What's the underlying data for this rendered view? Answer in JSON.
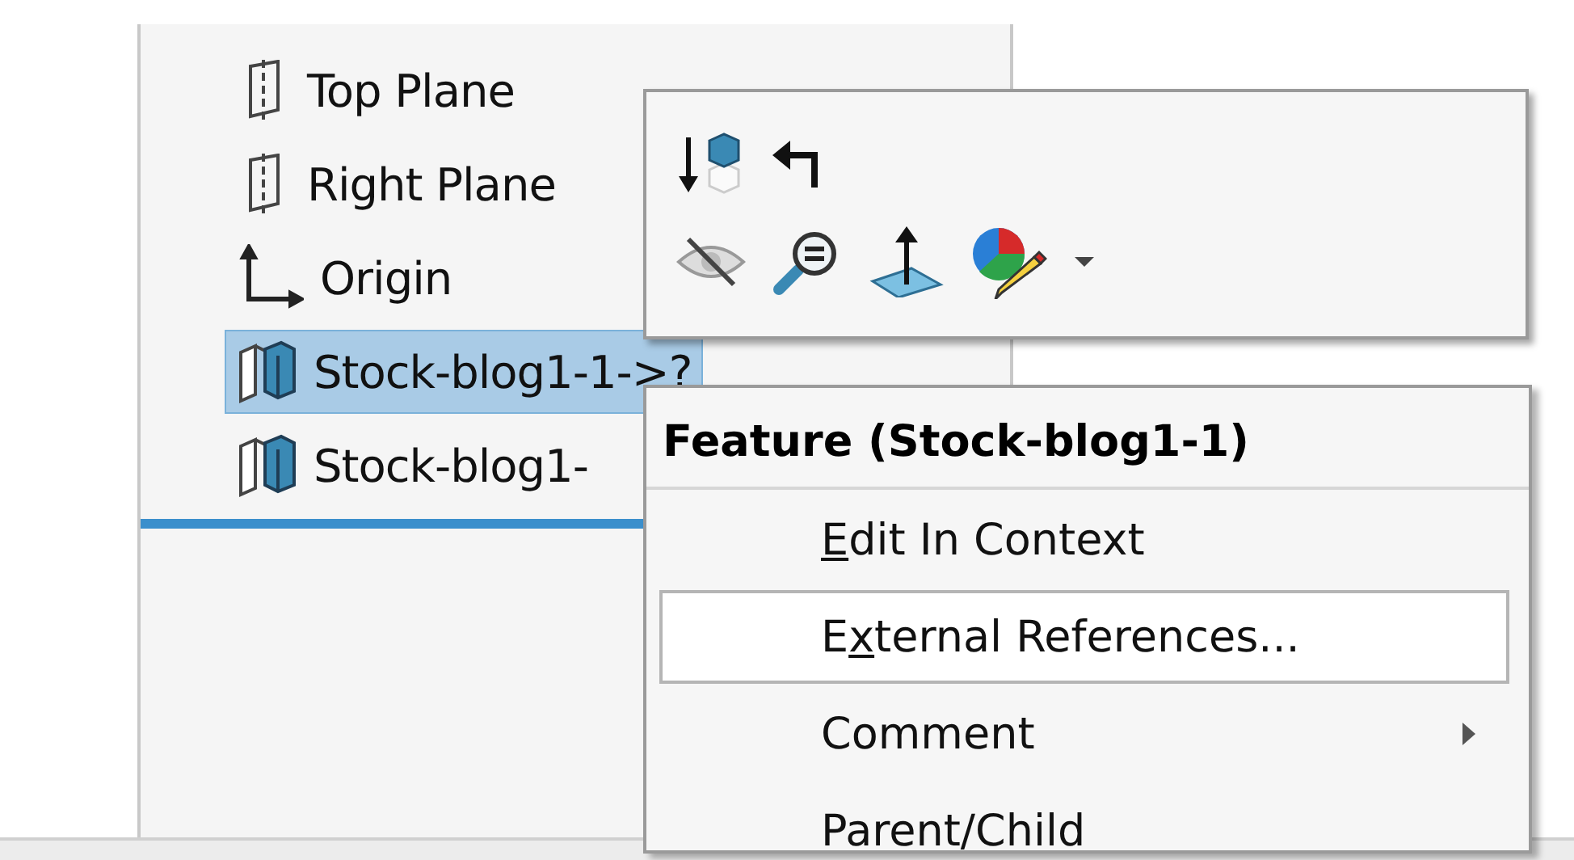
{
  "tree": {
    "items": [
      {
        "kind": "plane",
        "label": "Top Plane",
        "selected": false
      },
      {
        "kind": "plane",
        "label": "Right Plane",
        "selected": false
      },
      {
        "kind": "origin",
        "label": "Origin",
        "selected": false
      },
      {
        "kind": "part",
        "label": "Stock-blog1-1->?",
        "selected": true
      },
      {
        "kind": "part",
        "label": "Stock-blog1-",
        "selected": false
      }
    ]
  },
  "toolbar": {
    "rows": [
      [
        {
          "kind": "rollback"
        },
        {
          "kind": "return"
        }
      ],
      [
        {
          "kind": "hide"
        },
        {
          "kind": "zoom"
        },
        {
          "kind": "normal"
        },
        {
          "kind": "appearance"
        },
        {
          "kind": "caret"
        }
      ]
    ]
  },
  "menu": {
    "title": "Feature (Stock-blog1-1)",
    "items": [
      {
        "key": "E",
        "after": "dit In Context",
        "hovered": false,
        "submenu": false
      },
      {
        "before": "E",
        "key": "x",
        "after": "ternal References...",
        "hovered": true,
        "submenu": false
      },
      {
        "after": "Comment",
        "hovered": false,
        "submenu": true
      },
      {
        "after": "Parent/Child",
        "hovered": false,
        "submenu": false
      }
    ]
  }
}
